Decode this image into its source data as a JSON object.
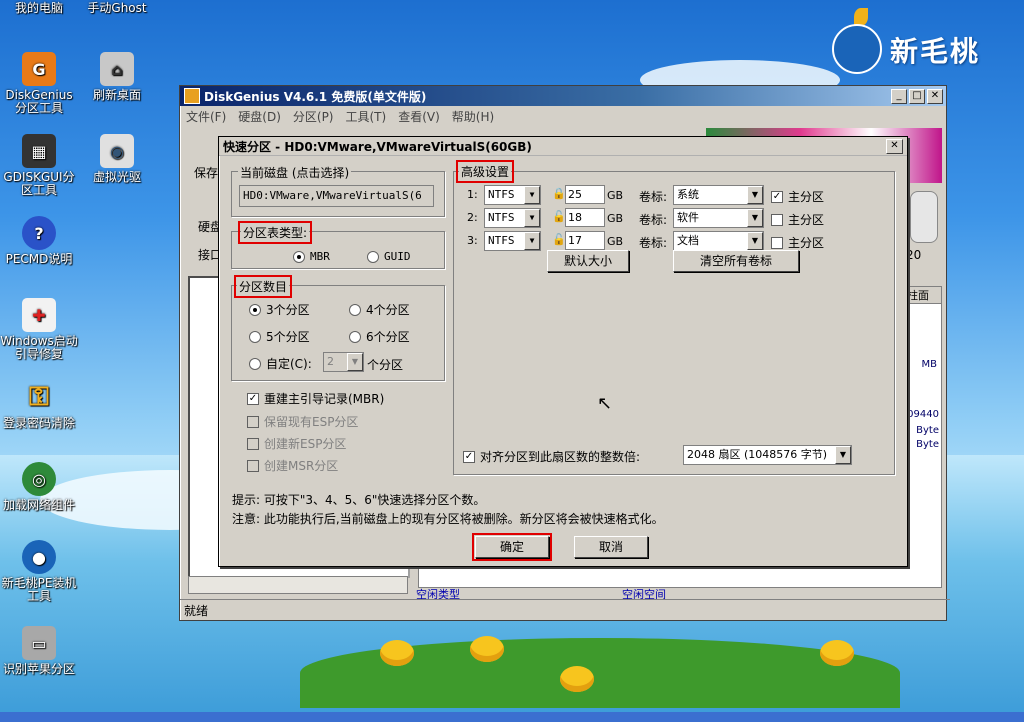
{
  "desktop": {
    "icons": [
      {
        "label": "我的电脑",
        "icon": "computer-icon"
      },
      {
        "label": "手动Ghost",
        "icon": "ghost-icon"
      },
      {
        "label": "DiskGenius分区工具",
        "icon": "diskgenius-icon"
      },
      {
        "label": "刷新桌面",
        "icon": "refresh-icon"
      },
      {
        "label": "GDISKGUI分区工具",
        "icon": "gdisk-icon"
      },
      {
        "label": "虚拟光驱",
        "icon": "cdrom-icon"
      },
      {
        "label": "PECMD说明",
        "icon": "help-icon"
      },
      {
        "label": "Windows启动引导修复",
        "icon": "repair-icon"
      },
      {
        "label": "登录密码清除",
        "icon": "key-icon"
      },
      {
        "label": "加载网络组件",
        "icon": "network-icon"
      },
      {
        "label": "新毛桃PE装机工具",
        "icon": "installer-icon"
      },
      {
        "label": "识别苹果分区",
        "icon": "apple-disk-icon"
      }
    ],
    "brand": "新毛桃"
  },
  "main_window": {
    "title": "DiskGenius V4.6.1 免费版(单文件版)",
    "menu": [
      "文件(F)",
      "硬盘(D)",
      "分区(P)",
      "工具(T)",
      "查看(V)",
      "帮助(H)"
    ],
    "toolbar_save": "保存",
    "side_label_1": "硬盘",
    "side_label_2": "接口",
    "column_partial": "柱面",
    "col_20": "20",
    "bottom_text_1": "空闲类型",
    "bottom_text_2": "空闲空间",
    "right_fragments": [
      "MB",
      "509440",
      "Byte",
      "Byte"
    ],
    "status": "就绪"
  },
  "dialog": {
    "title": "快速分区 - HD0:VMware,VMwareVirtualS(60GB)",
    "current_disk_label": "当前磁盘 (点击选择)",
    "current_disk_value": "HD0:VMware,VMwareVirtualS(6",
    "partition_table_label": "分区表类型:",
    "mbr": "MBR",
    "guid": "GUID",
    "partition_count_label": "分区数目",
    "count_3": "3个分区",
    "count_4": "4个分区",
    "count_5": "5个分区",
    "count_6": "6个分区",
    "custom": "自定(C):",
    "custom_value": "2",
    "custom_suffix": "个分区",
    "rebuild_mbr": "重建主引导记录(MBR)",
    "keep_esp": "保留现有ESP分区",
    "create_esp": "创建新ESP分区",
    "create_msr": "创建MSR分区",
    "advanced_label": "高级设置",
    "rows": [
      {
        "index": "1:",
        "fs": "NTFS",
        "size": "25",
        "unit": "GB",
        "vol_label": "卷标:",
        "name": "系统",
        "primary": "主分区",
        "primary_checked": true
      },
      {
        "index": "2:",
        "fs": "NTFS",
        "size": "18",
        "unit": "GB",
        "vol_label": "卷标:",
        "name": "软件",
        "primary": "主分区",
        "primary_checked": false
      },
      {
        "index": "3:",
        "fs": "NTFS",
        "size": "17",
        "unit": "GB",
        "vol_label": "卷标:",
        "name": "文档",
        "primary": "主分区",
        "primary_checked": false
      }
    ],
    "default_size_btn": "默认大小",
    "clear_labels_btn": "清空所有卷标",
    "align_label": "对齐分区到此扇区数的整数倍:",
    "align_value": "2048 扇区 (1048576 字节)",
    "hint1": "提示: 可按下\"3、4、5、6\"快速选择分区个数。",
    "hint2": "注意: 此功能执行后,当前磁盘上的现有分区将被删除。新分区将会被快速格式化。",
    "ok": "确定",
    "cancel": "取消"
  }
}
